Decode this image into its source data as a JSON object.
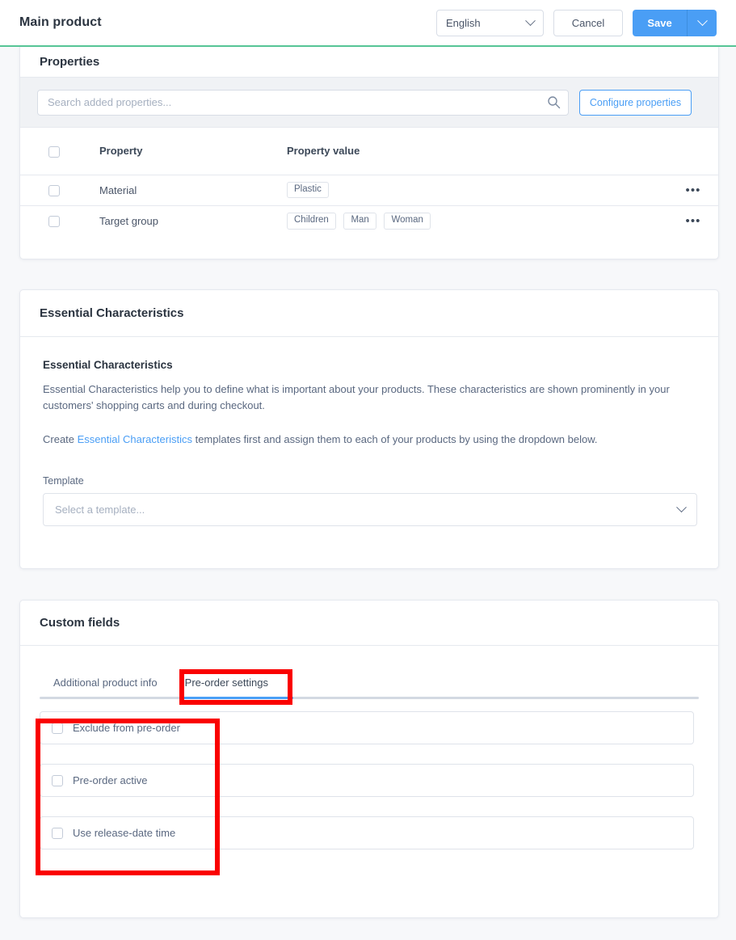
{
  "topbar": {
    "title": "Main product",
    "language_value": "English",
    "language_icon": "chevron-down-icon",
    "cancel_label": "Cancel",
    "save_label": "Save",
    "save_caret_icon": "chevron-down-icon",
    "accent_color": "#4a9ef5"
  },
  "progress": {
    "color": "#56c596"
  },
  "properties": {
    "title": "Properties",
    "search": {
      "placeholder": "Search added properties...",
      "value": "",
      "icon": "search-icon"
    },
    "configure_label": "Configure properties",
    "table": {
      "select_all_icon": "checkbox-unchecked-icon",
      "columns": [
        "Property",
        "Property value"
      ],
      "rows": [
        {
          "checkbox": "checkbox-unchecked-icon",
          "property": "Material",
          "values": [
            "Plastic"
          ],
          "menu_icon": "more-options-icon",
          "menu_label": "•••"
        },
        {
          "checkbox": "checkbox-unchecked-icon",
          "property": "Target group",
          "values": [
            "Children",
            "Man",
            "Woman"
          ],
          "menu_icon": "more-options-icon",
          "menu_label": "•••"
        }
      ]
    }
  },
  "essential_characteristics": {
    "card_title": "Essential Characteristics",
    "section_title": "Essential Characteristics",
    "paragraph_1": "Essential Characteristics help you to define what is important about your products. These characteristics are shown prominently in your customers' shopping carts and during checkout.",
    "paragraph_2_prefix": "Create ",
    "paragraph_2_link": "Essential Characteristics",
    "paragraph_2_suffix": " templates first and assign them to each of your products by using the dropdown below.",
    "template_label": "Template",
    "template_placeholder": "Select a template...",
    "template_caret_icon": "chevron-down-icon",
    "link_color": "#4a9ef5"
  },
  "custom_fields": {
    "card_title": "Custom fields",
    "tabs": [
      {
        "label": "Additional product info",
        "active": false
      },
      {
        "label": "Pre-order settings",
        "active": true
      }
    ],
    "active_tab_color": "#4a9ef5",
    "rows": [
      {
        "checkbox": "checkbox-unchecked-icon",
        "label": "Exclude from pre-order"
      },
      {
        "checkbox": "checkbox-unchecked-icon",
        "label": "Pre-order active"
      },
      {
        "checkbox": "checkbox-unchecked-icon",
        "label": "Use release-date time"
      }
    ]
  },
  "annotations": {
    "color": "#fa0000",
    "boxes": [
      "pre-order-settings-tab",
      "pre-order-checkbox-group"
    ]
  }
}
